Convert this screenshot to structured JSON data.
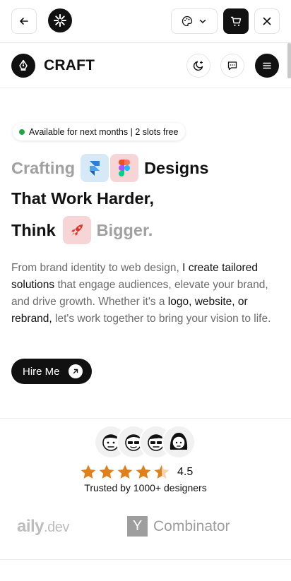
{
  "topbar": {
    "back_icon": "arrow-left-icon",
    "logo_icon": "asterisk-icon",
    "palette_icon": "palette-icon",
    "chevron_icon": "chevron-down-icon",
    "cart_icon": "cart-icon",
    "close_icon": "close-icon"
  },
  "header": {
    "brand_name": "CRAFT",
    "brand_icon": "pen-nib-icon",
    "theme_icon": "moon-icon",
    "chat_icon": "chat-icon",
    "menu_icon": "menu-icon"
  },
  "hero": {
    "badge": "Available for next months | 2 slots free",
    "line1_muted": "Crafting",
    "line1_dark": "Designs",
    "line2": "That Work Harder,",
    "line3_dark": "Think",
    "line3_muted": "Bigger.",
    "desc_1": "From brand identity to web design, ",
    "desc_2": "I create tailored solutions",
    "desc_3": " that engage audiences, elevate your brand, and drive growth. Whether it's a ",
    "desc_4": "logo, website, or rebrand,",
    "desc_5": " let's work together to bring your vision to life.",
    "cta_label": "Hire Me"
  },
  "social_proof": {
    "rating_value": "4.5",
    "stars": 4.5,
    "trusted_text": "Trusted by 1000+ designers",
    "logos": {
      "daily_main": "aily",
      "daily_dev": ".dev",
      "yc_letter": "Y",
      "yc_text": "Combinator"
    }
  },
  "colors": {
    "accent": "#111111",
    "available_dot": "#22a447",
    "star": "#e0801b",
    "muted_text": "#a0a0a0"
  }
}
